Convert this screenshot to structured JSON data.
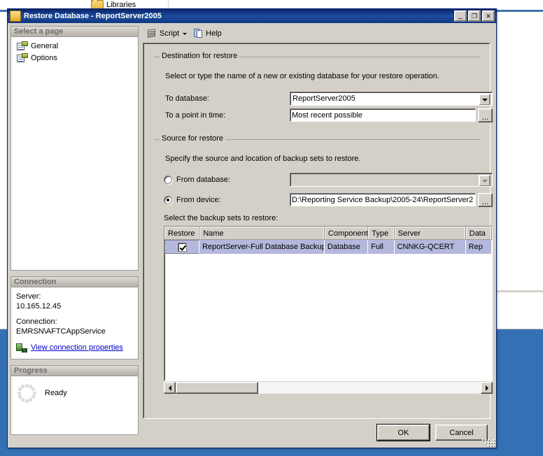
{
  "background": {
    "explorer_item_label": "Libraries",
    "folder_icon": "folder-icon"
  },
  "window": {
    "title": "Restore Database - ReportServer2005",
    "icon": "database-restore-icon",
    "minimize_label": "_",
    "maximize_label": "❐",
    "close_label": "✕"
  },
  "sidebar": {
    "pages_header": "Select a page",
    "pages": [
      {
        "label": "General",
        "icon": "page-icon"
      },
      {
        "label": "Options",
        "icon": "page-icon"
      }
    ],
    "connection_header": "Connection",
    "server_label": "Server:",
    "server_value": "10.165.12.45",
    "connection_label": "Connection:",
    "connection_value": "EMRSN\\AFTCAppService",
    "view_properties_link": "View connection properties",
    "view_properties_icon": "connection-properties-icon",
    "progress_header": "Progress",
    "progress_status": "Ready",
    "progress_icon": "spinner-icon"
  },
  "toolbar": {
    "script_label": "Script",
    "script_icon": "script-icon",
    "script_caret": "chevron-down-icon",
    "help_label": "Help",
    "help_icon": "help-icon"
  },
  "destination": {
    "legend": "Destination for restore",
    "description": "Select or type the name of a new or existing database for your restore operation.",
    "to_database_label": "To database:",
    "to_database_value": "ReportServer2005",
    "to_point_in_time_label": "To a point in time:",
    "to_point_in_time_value": "Most recent possible",
    "point_in_time_browse_label": "..."
  },
  "source": {
    "legend": "Source for restore",
    "description": "Specify the source and location of backup sets to restore.",
    "from_database_label": "From database:",
    "from_database_value": "",
    "from_database_selected": false,
    "from_device_label": "From device:",
    "from_device_value": "D:\\Reporting Service Backup\\2005-24\\ReportServer2",
    "from_device_selected": true,
    "device_browse_label": "...",
    "grid_label": "Select the backup sets to restore:"
  },
  "backup_grid": {
    "columns": [
      "Restore",
      "Name",
      "Component",
      "Type",
      "Server",
      "Data"
    ],
    "rows": [
      {
        "restore_checked": true,
        "name": "ReportServer-Full Database Backup",
        "component": "Database",
        "type": "Full",
        "server": "CNNKG-QCERT",
        "data": "Rep"
      }
    ]
  },
  "footer": {
    "ok_label": "OK",
    "cancel_label": "Cancel"
  },
  "colors": {
    "title_bar": "#0a246a",
    "dialog_face": "#d4d0c8",
    "selection_row": "#b4b8dc",
    "link": "#0000cc",
    "desktop": "#3371b4"
  }
}
